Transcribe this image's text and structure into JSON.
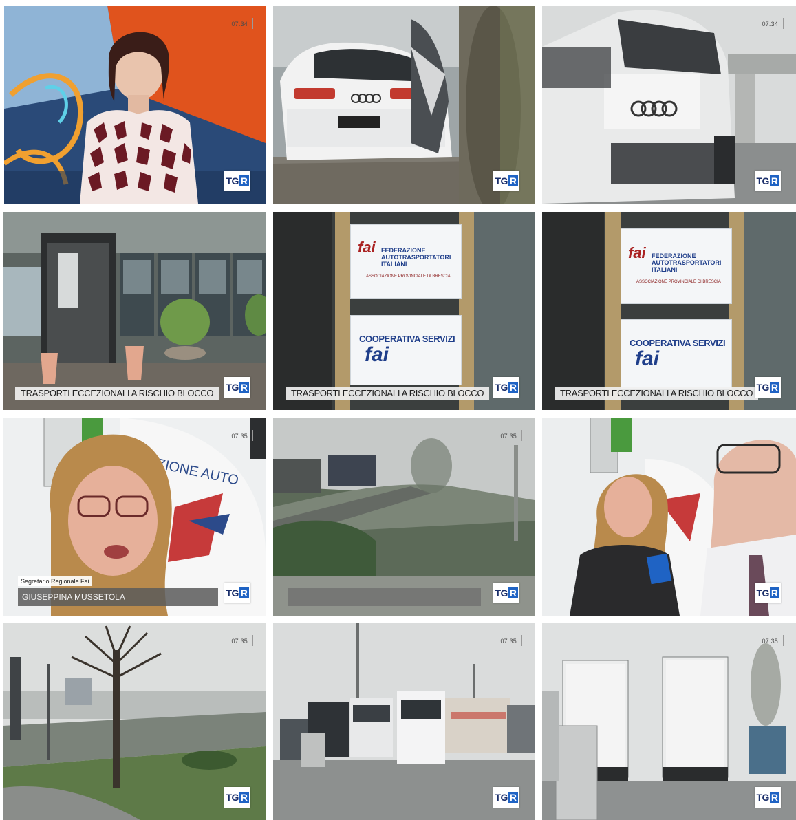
{
  "frames": [
    {
      "id": "frame-1",
      "clock": "07.34",
      "logo": "TG",
      "logo_r": "R",
      "ticker": "",
      "caption_role": "",
      "caption_name": ""
    },
    {
      "id": "frame-2",
      "clock": "",
      "logo": "TG",
      "logo_r": "R",
      "ticker": ""
    },
    {
      "id": "frame-3",
      "clock": "07.34",
      "logo": "TG",
      "logo_r": "R",
      "ticker": ""
    },
    {
      "id": "frame-4",
      "clock": "",
      "logo": "TG",
      "logo_r": "R",
      "ticker": "TRASPORTI ECCEZIONALI A RISCHIO BLOCCO"
    },
    {
      "id": "frame-5",
      "clock": "",
      "logo": "TG",
      "logo_r": "R",
      "ticker": "TRASPORTI ECCEZIONALI A RISCHIO BLOCCO"
    },
    {
      "id": "frame-6",
      "clock": "",
      "logo": "TG",
      "logo_r": "R",
      "ticker": "TRASPORTI ECCEZIONALI A RISCHIO BLOCCO"
    },
    {
      "id": "frame-7",
      "clock": "07.35",
      "logo": "TG",
      "logo_r": "R",
      "caption_role": "Segretario Regionale Fai",
      "caption_name": "GIUSEPPINA MUSSETOLA"
    },
    {
      "id": "frame-8",
      "clock": "07.35",
      "logo": "TG",
      "logo_r": "R"
    },
    {
      "id": "frame-9",
      "clock": "",
      "logo": "TG",
      "logo_r": "R"
    },
    {
      "id": "frame-10",
      "clock": "07.35",
      "logo": "TG",
      "logo_r": "R"
    },
    {
      "id": "frame-11",
      "clock": "07.35",
      "logo": "TG",
      "logo_r": "R"
    },
    {
      "id": "frame-12",
      "clock": "07.35",
      "logo": "TG",
      "logo_r": "R"
    }
  ],
  "sign": {
    "federazione": "FEDERAZIONE",
    "autotrasportatori": "AUTOTRASPORTATORI",
    "italiani": "ITALIANI",
    "associazione": "ASSOCIAZIONE PROVINCIALE DI BRESCIA",
    "cooperativa": "COOPERATIVA SERVIZI",
    "fai": "fai"
  },
  "flag_text": "AZIONE AUTO",
  "colors": {
    "logo_blue": "#1f63c4",
    "logo_navy": "#1b2f6b",
    "sign_blue": "#1f3e8a",
    "anchor_orange": "#e0531d"
  }
}
